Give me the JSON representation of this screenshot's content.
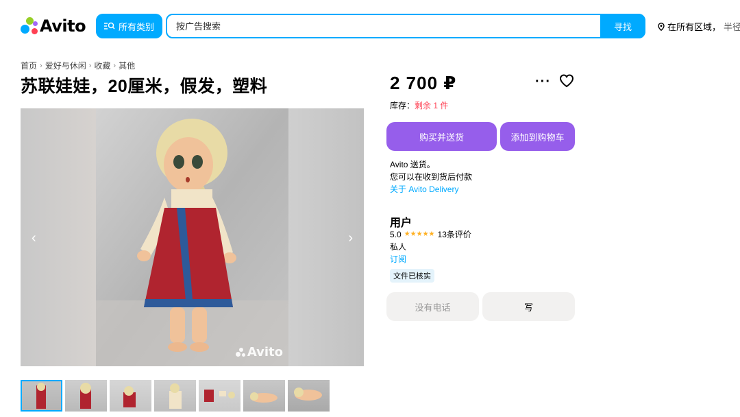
{
  "header": {
    "logo_text": "Avito",
    "categories_label": "所有类别",
    "search_placeholder": "按广告搜索",
    "search_button": "寻找",
    "location_label": "在所有区域，",
    "location_sub": "半径"
  },
  "breadcrumb": [
    "首页",
    "爱好与休闲",
    "收藏",
    "其他"
  ],
  "listing": {
    "title": "苏联娃娃，20厘米，假发，塑料",
    "price": "2 700 ₽",
    "stock_label": "库存：",
    "stock_value": "剩余 1 件",
    "buy_button": "购买并送货",
    "cart_button": "添加到购物车",
    "delivery_line1": "Avito 送货。",
    "delivery_line2": "您可以在收到货后付款",
    "delivery_link": "关于 Avito Delivery"
  },
  "gallery": {
    "watermark": "Avito",
    "thumbnail_count": 7,
    "active_thumbnail": 1
  },
  "seller": {
    "name": "用户",
    "rating": "5.0",
    "stars": "★★★★★",
    "reviews": "13条评价",
    "type": "私人",
    "subscribe": "订阅",
    "verified_badge": "文件已核实"
  },
  "contact": {
    "phone_button": "没有电话",
    "write_button": "写"
  },
  "colors": {
    "brand_blue": "#00aaff",
    "purple": "#965eeb",
    "stock_red": "#ff4053",
    "star": "#ffb021"
  }
}
